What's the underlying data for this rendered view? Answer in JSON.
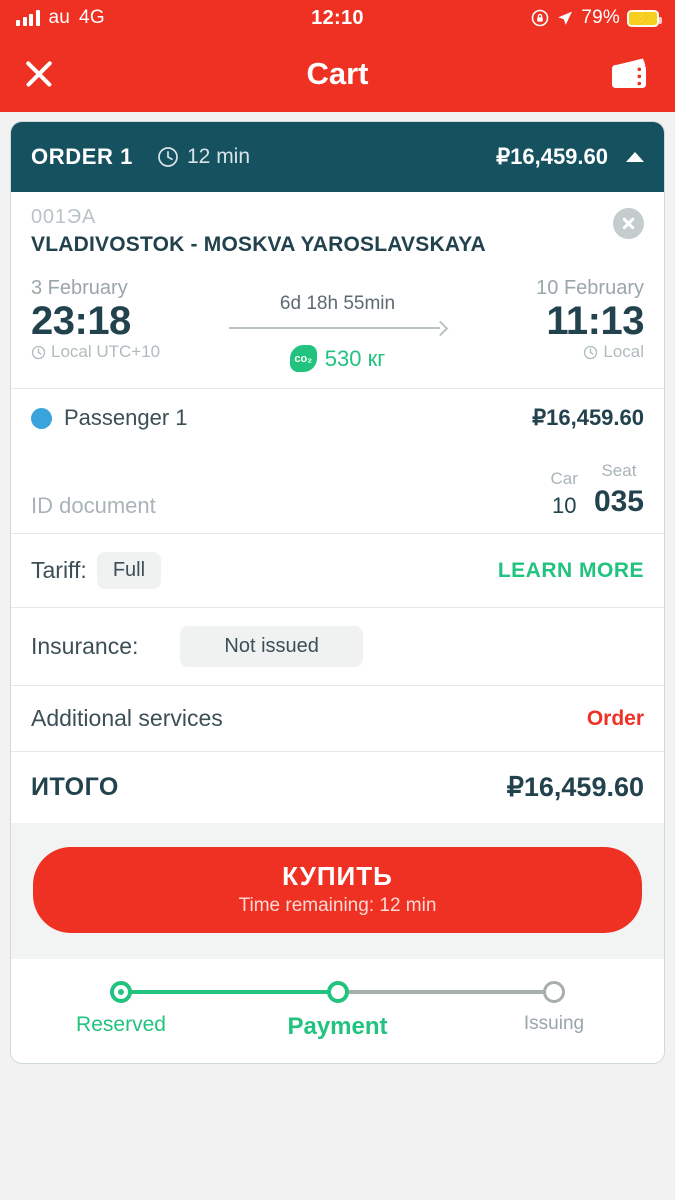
{
  "status_bar": {
    "carrier": "au",
    "network": "4G",
    "time": "12:10",
    "battery_percent": "79%",
    "icons": [
      "signal-bars-icon",
      "rotation-lock-icon",
      "location-arrow-icon",
      "battery-charging-icon"
    ]
  },
  "nav": {
    "title": "Cart",
    "close_icon": "close-icon",
    "wallet_icon": "wallet-icon"
  },
  "order": {
    "label": "ORDER 1",
    "timer": "12 min",
    "price": "₽16,459.60",
    "collapse_icon": "chevron-up-icon"
  },
  "trip": {
    "train_number": "001ЭА",
    "route": "VLADIVOSTOK - MOSKVA YAROSLAVSKAYA",
    "depart": {
      "date": "3 February",
      "time": "23:18",
      "zone": "Local UTC+10"
    },
    "arrive": {
      "date": "10 February",
      "time": "11:13",
      "zone": "Local"
    },
    "duration": "6d 18h 55min",
    "co2_badge": "co₂",
    "co2_value": "530 кг"
  },
  "passenger": {
    "name": "Passenger 1",
    "price": "₽16,459.60",
    "id_document": "ID document",
    "car_label": "Car",
    "seat_label": "Seat",
    "car_value": "10",
    "seat_value": "035"
  },
  "tariff": {
    "label": "Tariff:",
    "value": "Full",
    "action": "LEARN MORE"
  },
  "insurance": {
    "label": "Insurance:",
    "value": "Not issued"
  },
  "additional_services": {
    "label": "Additional services",
    "action": "Order"
  },
  "total": {
    "label": "ИТОГО",
    "value": "₽16,459.60"
  },
  "buy": {
    "label": "КУПИТЬ",
    "sublabel": "Time remaining: 12 min"
  },
  "stepper": {
    "steps": [
      {
        "label": "Reserved",
        "state": "done"
      },
      {
        "label": "Payment",
        "state": "current"
      },
      {
        "label": "Issuing",
        "state": "pending"
      }
    ]
  },
  "colors": {
    "brand_red": "#ef3124",
    "header_teal": "#15515e",
    "accent_green": "#22c37e",
    "passenger_blue": "#3ba3db",
    "page_bg": "#f2f2f2"
  }
}
